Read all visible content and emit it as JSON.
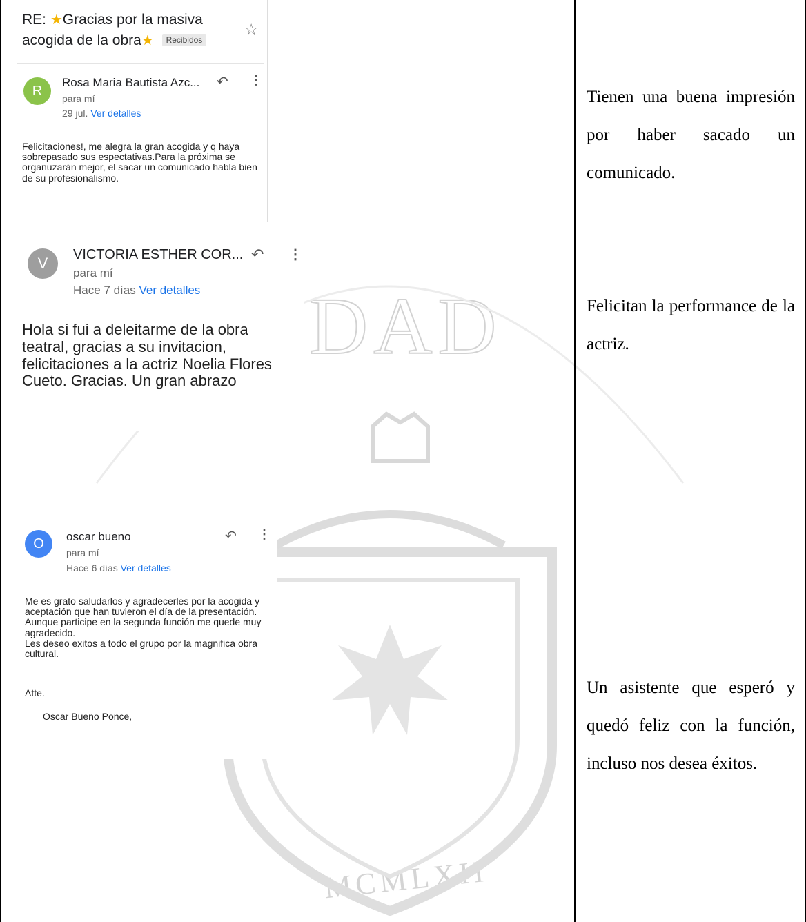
{
  "emails": [
    {
      "subject": "RE: ⭐ Gracias por la masiva acogida de la obra ⭐",
      "subject_parts": [
        "RE: ",
        "Gracias por la masiva acogida de la obra"
      ],
      "label": "Recibidos",
      "avatar_letter": "R",
      "avatar_color": "#8bc34a",
      "sender": "Rosa Maria Bautista Azc...",
      "to": "para mí",
      "date": "29 jul.",
      "details_link": "Ver detalles",
      "body": "Felicitaciones!, me alegra la gran acogida y q haya sobrepasado sus espectativas.Para la próxima se organuzarán mejor, el sacar un comunicado habla bien de su profesionalismo."
    },
    {
      "avatar_letter": "V",
      "avatar_color": "#9e9e9e",
      "sender": "VICTORIA ESTHER COR...",
      "to": "para mí",
      "date": "Hace 7 días",
      "details_link": "Ver detalles",
      "body": "Hola si fui a deleitarme de la obra teatral, gracias a su invitacion, felicitaciones a la actriz Noelia Flores Cueto. Gracias. Un gran abrazo"
    },
    {
      "avatar_letter": "O",
      "avatar_color": "#4285f4",
      "sender": "oscar bueno",
      "to": "para mí",
      "date": "Hace 6 días",
      "details_link": "Ver detalles",
      "body_lines": [
        "Me es grato saludarlos y agradecerles  por la acogida y aceptación que han tuvieron el día de la presentación.",
        "Aunque participe en la segunda función me quede muy agradecido.",
        "Les deseo exitos a todo el grupo por la magnifica obra cultural."
      ],
      "closing": "Atte.",
      "signature": "Oscar Bueno Ponce,"
    }
  ],
  "comments": [
    "Tienen una buena impresión por haber sacado un comunicado.",
    "Felicitan la performance de la actriz.",
    "Un asistente que esperó y quedó feliz con la función, incluso nos desea éxitos."
  ],
  "watermark": {
    "top_text": "DAD",
    "year": "MCMLXII"
  },
  "icons": {
    "favorite": "star-outline-icon",
    "reply": "reply-icon",
    "more": "more-vert-icon",
    "subject_star": "star-emoji-icon"
  },
  "colors": {
    "link": "#1a73e8",
    "star": "#f4b400"
  }
}
